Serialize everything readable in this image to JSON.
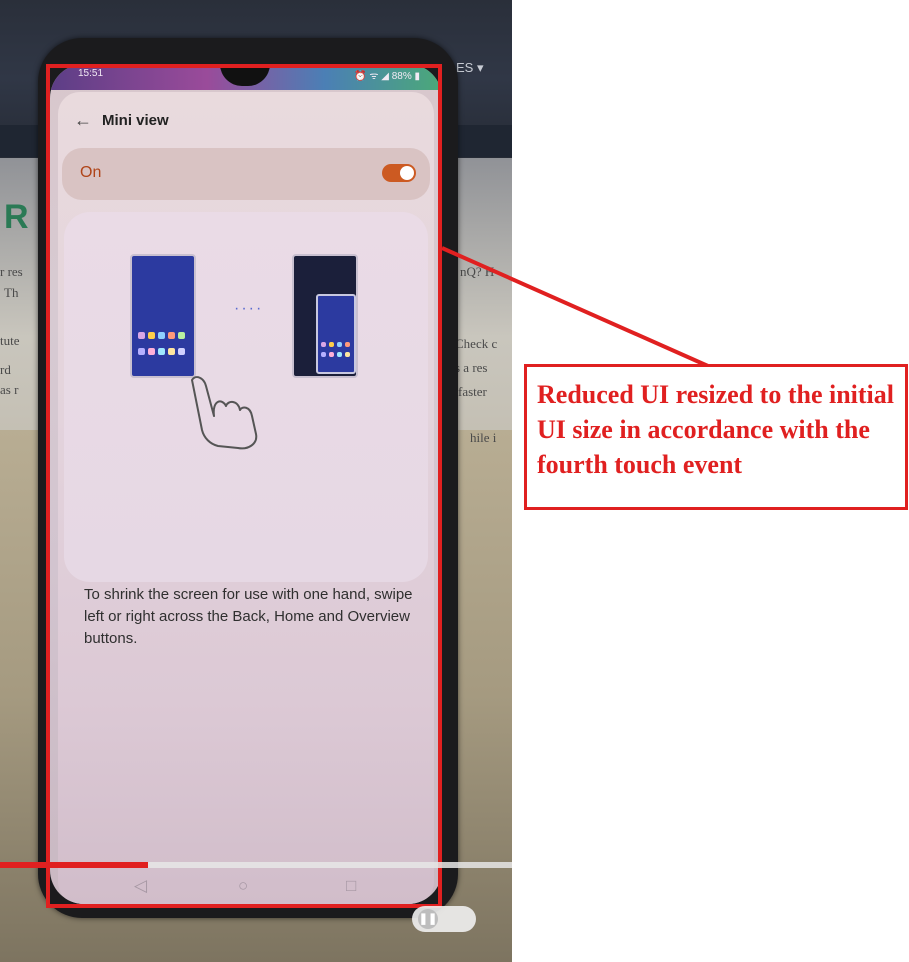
{
  "status_bar": {
    "time": "15:51",
    "icons_text": "⏰ ᯤ ◢ 88% ▮"
  },
  "settings": {
    "title": "Mini view",
    "back_icon": "back-arrow-icon",
    "toggle_label": "On",
    "toggle_state": true,
    "description": "To shrink the screen for use with one hand, swipe left or right across the Back, Home and Overview buttons."
  },
  "navigation": {
    "back": "◁",
    "home": "○",
    "overview": "□"
  },
  "background_text": {
    "monitor_label": "ES ▾",
    "big_letter": "R",
    "side_left": [
      "r res",
      "Th",
      "tute",
      "rd",
      "as r"
    ],
    "side_right": [
      "nQ? H",
      "Check c",
      "s a res",
      "faster",
      "hile i"
    ]
  },
  "video_player": {
    "progress": 0.29,
    "pause_icon": "pause-icon"
  },
  "annotation": {
    "callout_text": "Reduced UI resized to the initial UI size in accordance with the fourth touch event",
    "color": "#e02020"
  }
}
